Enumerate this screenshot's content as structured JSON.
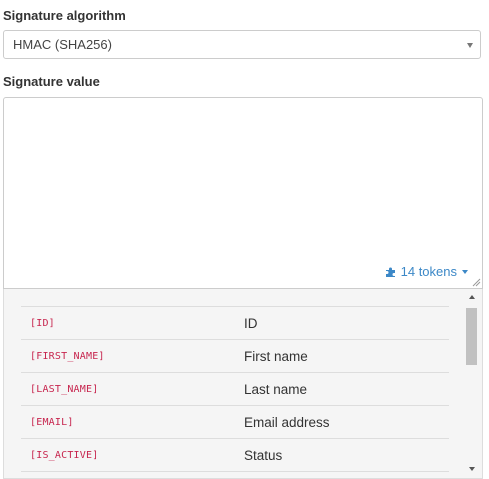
{
  "signature_algorithm": {
    "label": "Signature algorithm",
    "selected": "HMAC (SHA256)"
  },
  "signature_value": {
    "label": "Signature value",
    "value": "",
    "tokens_link": "14 tokens"
  },
  "tokens": [
    {
      "code": "[ID]",
      "description": "ID"
    },
    {
      "code": "[FIRST_NAME]",
      "description": "First name"
    },
    {
      "code": "[LAST_NAME]",
      "description": "Last name"
    },
    {
      "code": "[EMAIL]",
      "description": "Email address"
    },
    {
      "code": "[IS_ACTIVE]",
      "description": "Status"
    }
  ],
  "colors": {
    "token_code": "#c7254e",
    "link": "#3c88c7",
    "panel_bg": "#f5f5f5"
  },
  "icons": {
    "tokens_link_icon": "puzzle-icon"
  }
}
